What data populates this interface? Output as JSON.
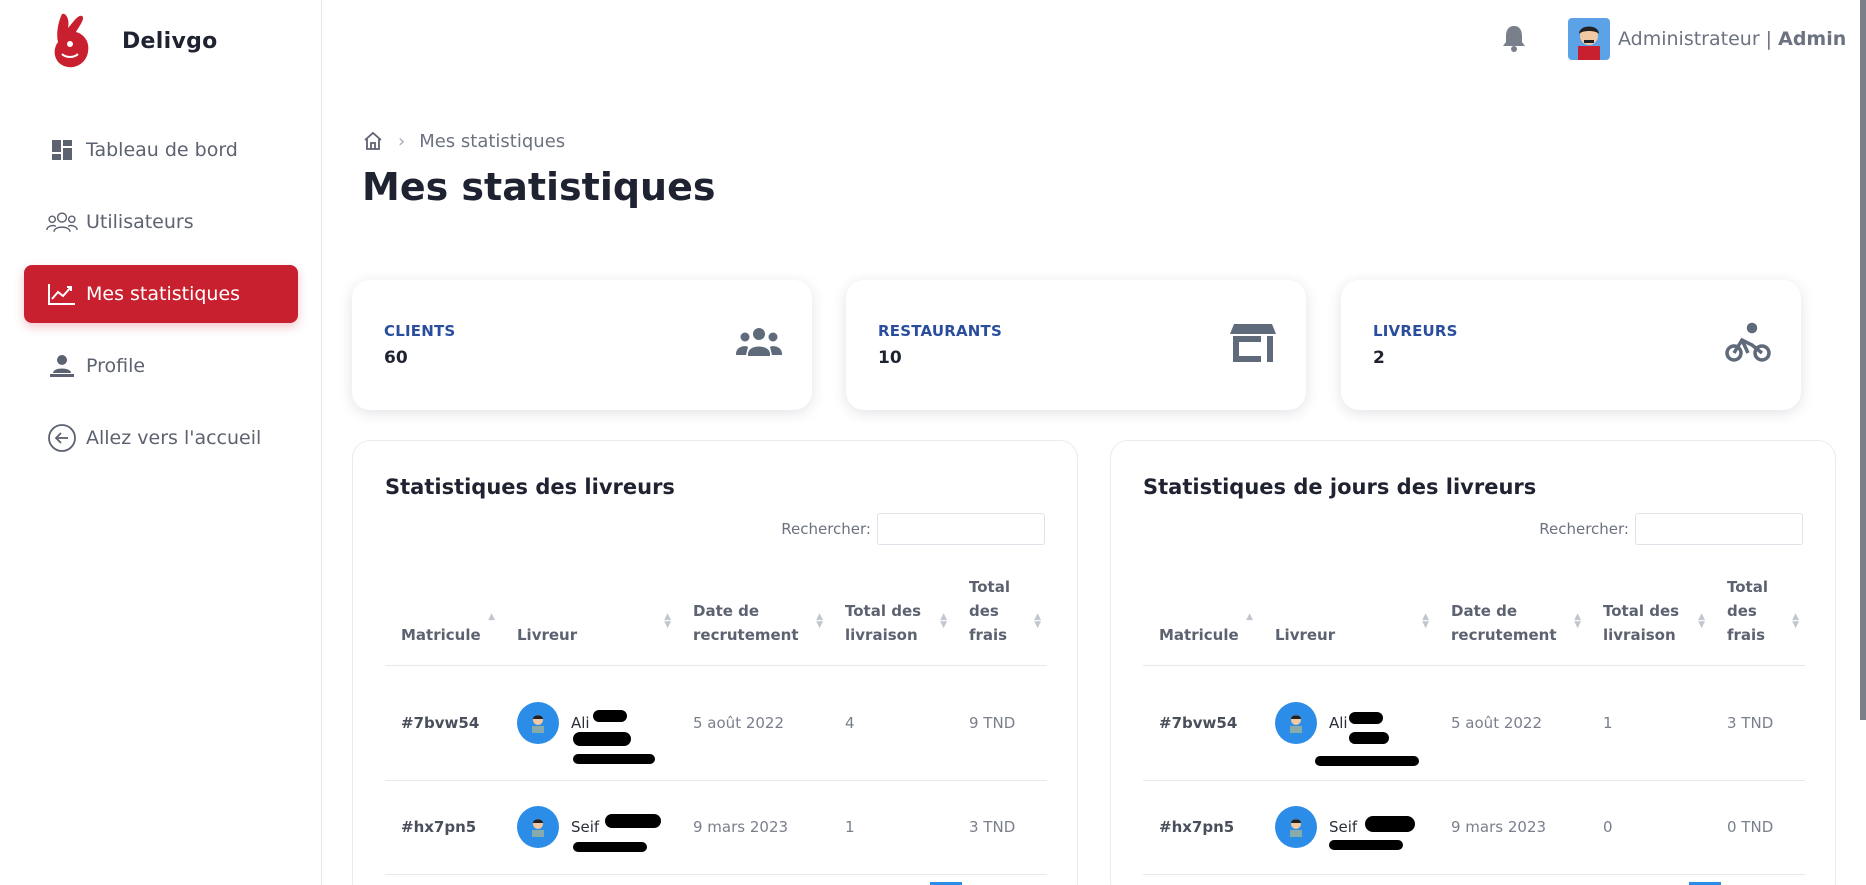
{
  "brand": {
    "name": "Delivgo"
  },
  "sidebar": {
    "items": [
      {
        "label": "Tableau de bord",
        "icon": "dashboard-icon"
      },
      {
        "label": "Utilisateurs",
        "icon": "users-icon"
      },
      {
        "label": "Mes statistiques",
        "icon": "chart-trend-icon"
      },
      {
        "label": "Profile",
        "icon": "profile-icon"
      },
      {
        "label": "Allez vers l'accueil",
        "icon": "arrow-left-circle-icon"
      }
    ]
  },
  "header": {
    "user_role": "Administrateur",
    "separator": " | ",
    "user_name": "Admin"
  },
  "breadcrumb": {
    "current": "Mes statistiques"
  },
  "page": {
    "title": "Mes statistiques"
  },
  "stats": [
    {
      "label": "CLIENTS",
      "value": "60",
      "icon": "users-group-icon"
    },
    {
      "label": "RESTAURANTS",
      "value": "10",
      "icon": "store-icon"
    },
    {
      "label": "LIVREURS",
      "value": "2",
      "icon": "bicycle-icon"
    }
  ],
  "colors": {
    "accent": "#c8202f",
    "card_label": "#2a4e9d",
    "avatar_bg": "#2b8de8"
  },
  "panels": [
    {
      "title": "Statistiques des livreurs",
      "search_label": "Rechercher:",
      "columns": [
        "Matricule",
        "Livreur",
        "Date de recrutement",
        "Total des livraison",
        "Total des frais"
      ],
      "rows": [
        {
          "matricule": "#7bvw54",
          "livreur": "Ali",
          "date": "5 août 2022",
          "livraison": "4",
          "frais": "9 TND"
        },
        {
          "matricule": "#hx7pn5",
          "livreur": "Seif",
          "date": "9 mars 2023",
          "livraison": "1",
          "frais": "3 TND"
        }
      ]
    },
    {
      "title": "Statistiques de jours des livreurs",
      "search_label": "Rechercher:",
      "columns": [
        "Matricule",
        "Livreur",
        "Date de recrutement",
        "Total des livraison",
        "Total des frais"
      ],
      "rows": [
        {
          "matricule": "#7bvw54",
          "livreur": "Ali",
          "date": "5 août 2022",
          "livraison": "1",
          "frais": "3 TND"
        },
        {
          "matricule": "#hx7pn5",
          "livreur": "Seif",
          "date": "9 mars 2023",
          "livraison": "0",
          "frais": "0 TND"
        }
      ]
    }
  ]
}
